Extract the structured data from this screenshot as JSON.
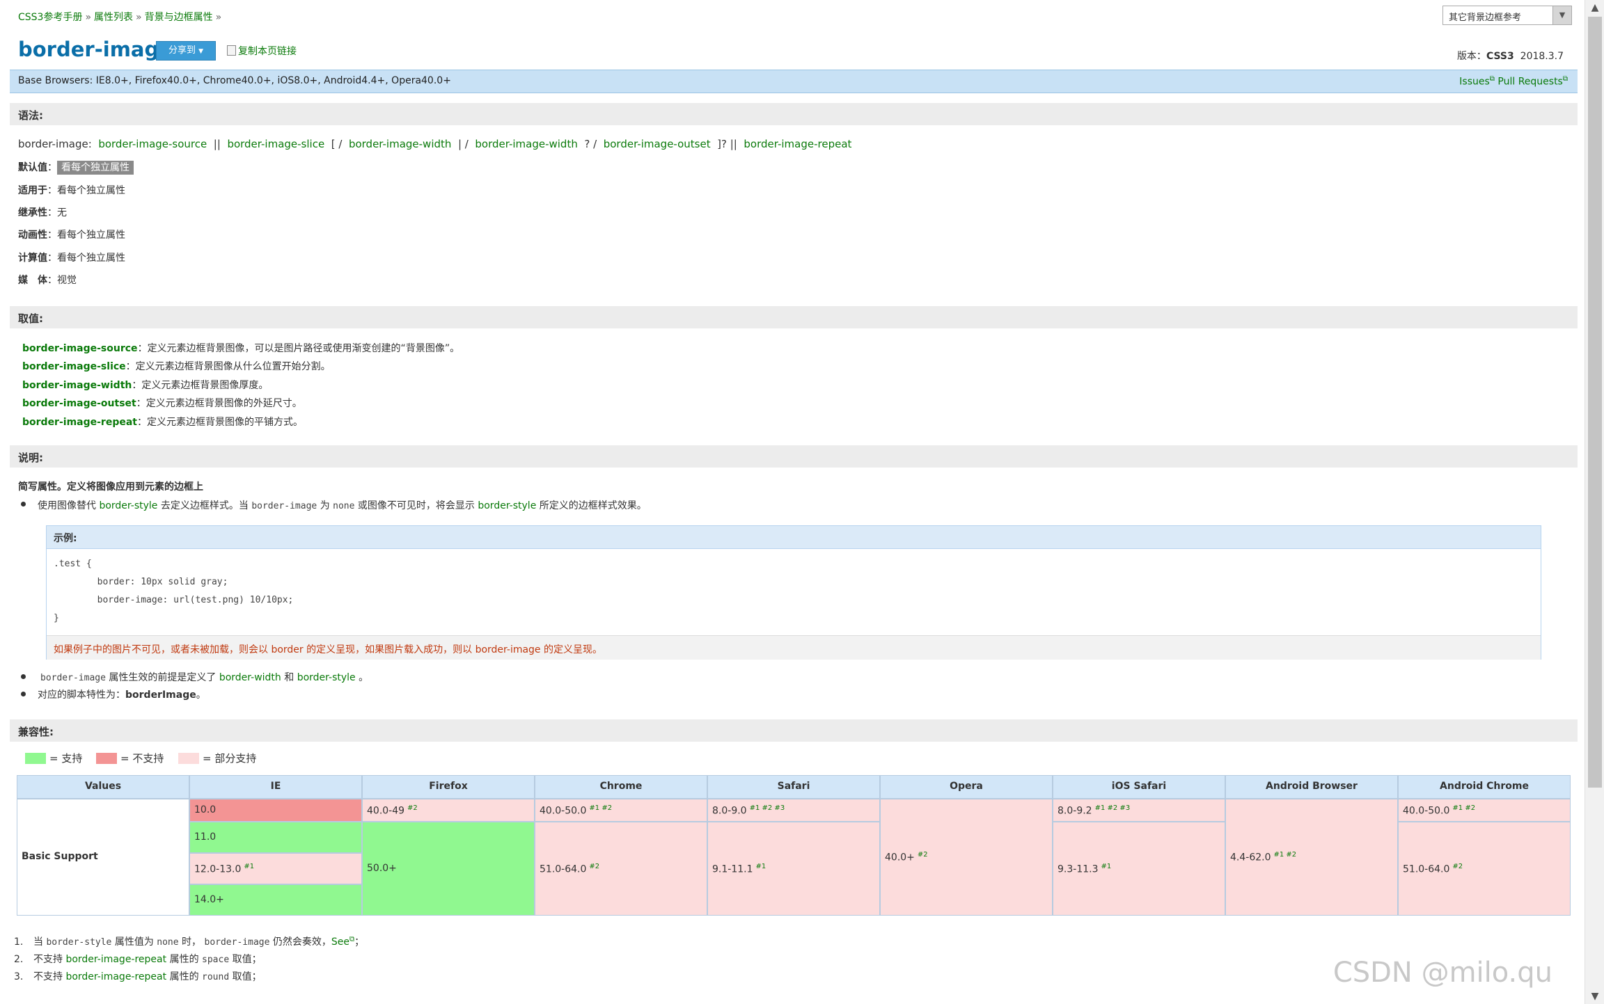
{
  "breadcrumb": [
    "CSS3参考手册",
    "属性列表",
    "背景与边框属性"
  ],
  "breadcrumb_sep": "»",
  "other_select": "其它背景边框参考",
  "title": "border-image",
  "share_label": "分享到",
  "copy_link_label": "复制本页链接",
  "version_label": "版本：",
  "version_value": "CSS3",
  "version_date": "2018.3.7",
  "browsers_text": "Base Browsers: IE8.0+, Firefox40.0+, Chrome40.0+, iOS8.0+, Android4.4+, Opera40.0+",
  "issues_label": "Issues",
  "pull_label": "Pull Requests",
  "sections": {
    "syntax": "语法:",
    "values": "取值:",
    "description": "说明:",
    "compat": "兼容性:"
  },
  "syntax": {
    "prop": "border-image",
    "colon": ":",
    "source": "border-image-source",
    "s1": "||",
    "slice": "border-image-slice",
    "s2": "[ /",
    "width1": "border-image-width",
    "s3": "| /",
    "width2": "border-image-width",
    "s4": "? /",
    "outset": "border-image-outset",
    "s5": "]? ||",
    "repeat": "border-image-repeat"
  },
  "props": [
    {
      "k": "默认值",
      "v": "看每个独立属性"
    },
    {
      "k": "适用于",
      "v": "看每个独立属性"
    },
    {
      "k": "继承性",
      "v": "无"
    },
    {
      "k": "动画性",
      "v": "看每个独立属性"
    },
    {
      "k": "计算值",
      "v": "看每个独立属性"
    },
    {
      "k": "媒　体",
      "v": "视觉"
    }
  ],
  "values": [
    {
      "name": "border-image-source",
      "desc": "定义元素边框背景图像，可以是图片路径或使用渐变创建的“背景图像”。"
    },
    {
      "name": "border-image-slice",
      "desc": "定义元素边框背景图像从什么位置开始分割。"
    },
    {
      "name": "border-image-width",
      "desc": "定义元素边框背景图像厚度。"
    },
    {
      "name": "border-image-outset",
      "desc": "定义元素边框背景图像的外延尺寸。"
    },
    {
      "name": "border-image-repeat",
      "desc": "定义元素边框背景图像的平铺方式。"
    }
  ],
  "desc": {
    "intro": "简写属性。定义将图像应用到元素的边框上",
    "b1_a": "使用图像替代",
    "b1_link1": "border-style",
    "b1_b": "去定义边框样式。当",
    "b1_code1": "border-image",
    "b1_c": "为",
    "b1_code2": "none",
    "b1_d": "或图像不可见时，将会显示",
    "b1_link2": "border-style",
    "b1_e": "所定义的边框样式效果。",
    "example_title": "示例:",
    "code": [
      ".test {",
      "        border: 10px solid gray;",
      "        border-image: url(test.png) 10/10px;",
      "}"
    ],
    "example_note": "如果例子中的图片不可见，或者未被加载，则会以 border 的定义呈现，如果图片载入成功，则以 border-image 的定义呈现。",
    "b2_code": "border-image",
    "b2_a": "属性生效的前提是定义了",
    "b2_link1": "border-width",
    "b2_and": "和",
    "b2_link2": "border-style",
    "b2_end": "。",
    "b3_a": "对应的脚本特性为：",
    "b3_b": "borderImage",
    "b3_end": "。"
  },
  "legend": [
    {
      "color": "#90f890",
      "label": "= 支持"
    },
    {
      "color": "#f39494",
      "label": "= 不支持"
    },
    {
      "color": "#fcdcdc",
      "label": "= 部分支持"
    }
  ],
  "table": {
    "headers": [
      "Values",
      "IE",
      "Firefox",
      "Chrome",
      "Safari",
      "Opera",
      "iOS Safari",
      "Android Browser",
      "Android Chrome"
    ],
    "row_label": "Basic Support",
    "ie": [
      {
        "v": "10.0",
        "s": "r"
      },
      {
        "v": "11.0",
        "s": "g"
      },
      {
        "v": "12.0-13.0",
        "sup": "#1",
        "s": "p"
      },
      {
        "v": "14.0+",
        "s": "g"
      }
    ],
    "firefox": [
      {
        "v": "40.0-49",
        "sup": "#2",
        "s": "p"
      },
      {
        "v": "50.0+",
        "s": "g"
      }
    ],
    "chrome": [
      {
        "v": "40.0-50.0",
        "sup": "#1 #2",
        "s": "p"
      },
      {
        "v": "51.0-64.0",
        "sup": "#2",
        "s": "p"
      }
    ],
    "safari": [
      {
        "v": "8.0-9.0",
        "sup": "#1 #2 #3",
        "s": "p"
      },
      {
        "v": "9.1-11.1",
        "sup": "#1",
        "s": "p"
      }
    ],
    "opera": [
      {
        "v": "40.0+",
        "sup": "#2",
        "s": "p"
      }
    ],
    "ios": [
      {
        "v": "8.0-9.2",
        "sup": "#1 #2 #3",
        "s": "p"
      },
      {
        "v": "9.3-11.3",
        "sup": "#1",
        "s": "p"
      }
    ],
    "android": [
      {
        "v": "4.4-62.0",
        "sup": "#1 #2",
        "s": "p"
      }
    ],
    "achrome": [
      {
        "v": "40.0-50.0",
        "sup": "#1 #2",
        "s": "p"
      },
      {
        "v": "51.0-64.0",
        "sup": "#2",
        "s": "p"
      }
    ]
  },
  "notes": [
    {
      "n": "1.",
      "a": "当",
      "c1": "border-style",
      "b": "属性值为",
      "c2": "none",
      "c": "时，",
      "c3": "border-image",
      "d": "仍然会奏效，",
      "link": "See",
      "e": "；"
    },
    {
      "n": "2.",
      "a": "不支持",
      "link": "border-image-repeat",
      "b": "属性的",
      "c1": "space",
      "c": "取值；"
    },
    {
      "n": "3.",
      "a": "不支持",
      "link": "border-image-repeat",
      "b": "属性的",
      "c1": "round",
      "c": "取值；"
    }
  ],
  "watermark": "CSDN @milo.qu"
}
